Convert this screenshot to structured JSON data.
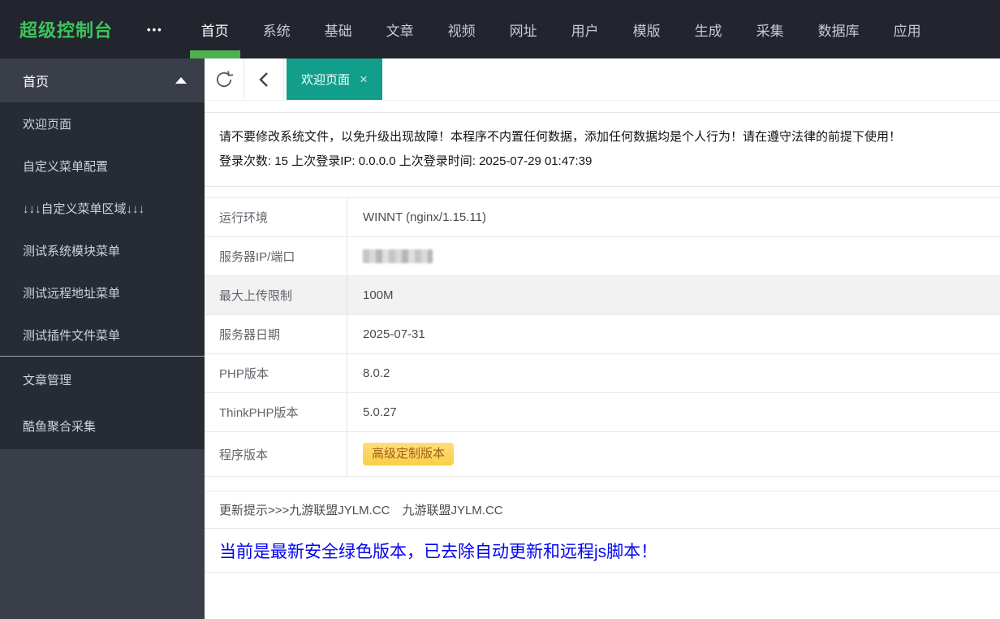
{
  "topbar": {
    "brand": "超级控制台",
    "menu_toggle": "•••",
    "nav": [
      {
        "label": "首页",
        "active": true
      },
      {
        "label": "系统",
        "active": false
      },
      {
        "label": "基础",
        "active": false
      },
      {
        "label": "文章",
        "active": false
      },
      {
        "label": "视频",
        "active": false
      },
      {
        "label": "网址",
        "active": false
      },
      {
        "label": "用户",
        "active": false
      },
      {
        "label": "模版",
        "active": false
      },
      {
        "label": "生成",
        "active": false
      },
      {
        "label": "采集",
        "active": false
      },
      {
        "label": "数据库",
        "active": false
      },
      {
        "label": "应用",
        "active": false
      }
    ]
  },
  "sidebar": {
    "active_group": {
      "label": "首页",
      "expanded": true,
      "items": [
        {
          "label": "欢迎页面"
        },
        {
          "label": "自定义菜单配置"
        },
        {
          "label": "↓↓↓自定义菜单区域↓↓↓"
        },
        {
          "label": "测试系统模块菜单"
        },
        {
          "label": "测试远程地址菜单"
        },
        {
          "label": "测试插件文件菜单"
        }
      ]
    },
    "other_groups": [
      {
        "label": "文章管理"
      },
      {
        "label": "酷鱼聚合采集"
      }
    ]
  },
  "tabbar": {
    "active_tab": "欢迎页面",
    "close_label": "×"
  },
  "notice": {
    "line1": "请不要修改系统文件，以免升级出现故障！本程序不内置任何数据，添加任何数据均是个人行为！请在遵守法律的前提下使用！",
    "line2": "登录次数: 15 上次登录IP: 0.0.0.0 上次登录时间: 2025-07-29 01:47:39"
  },
  "info_table": {
    "rows": [
      {
        "label": "运行环境",
        "value": "WINNT (nginx/1.15.11)"
      },
      {
        "label": "服务器IP/端口",
        "value": "",
        "masked": true
      },
      {
        "label": "最大上传限制",
        "value": "100M",
        "shaded": true
      },
      {
        "label": "服务器日期",
        "value": "2025-07-31"
      },
      {
        "label": "PHP版本",
        "value": "8.0.2"
      },
      {
        "label": "ThinkPHP版本",
        "value": "5.0.27"
      },
      {
        "label": "程序版本",
        "value": "高级定制版本",
        "badge": true
      }
    ]
  },
  "update_row": {
    "text": "更新提示>>>九游联盟JYLM.CC　九游联盟JYLM.CC"
  },
  "version_notice": "当前是最新安全绿色版本，已去除自动更新和远程js脚本！",
  "colors": {
    "topbar_bg": "#22252d",
    "brand_green": "#3cc45c",
    "nav_underline_green": "#4db150",
    "sidebar_bg": "#3a3e49",
    "sidebar_submenu_bg": "#272b34",
    "tab_teal": "#119e8b",
    "badge_yellow": "#fbce47",
    "badge_text": "#9f611a",
    "version_notice_blue": "#0505f0",
    "shaded_row": "#f2f2f2"
  }
}
